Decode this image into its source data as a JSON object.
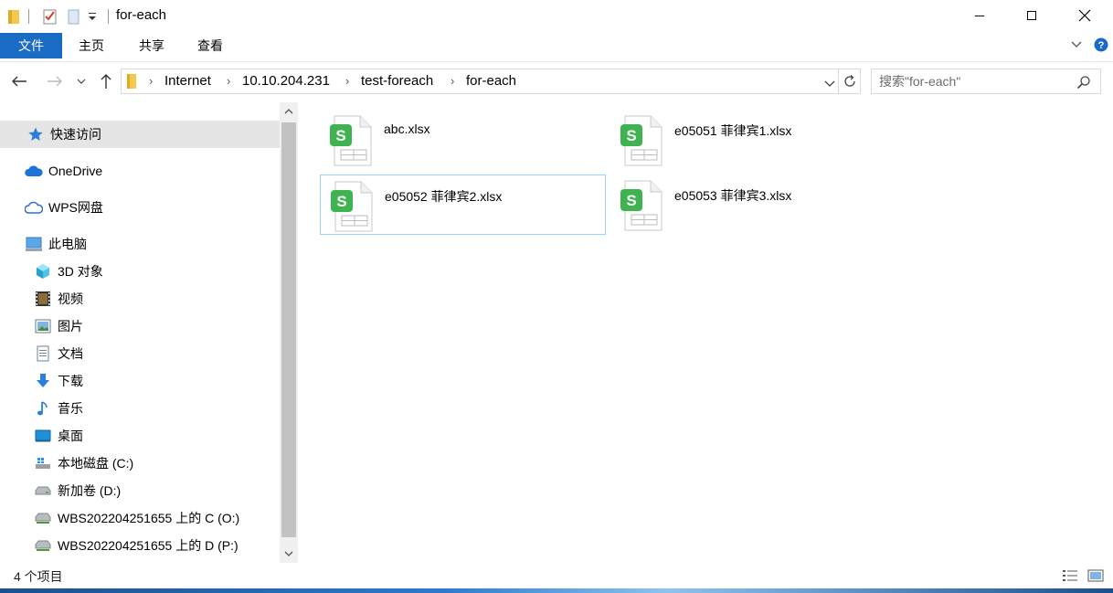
{
  "window": {
    "title": "for-each"
  },
  "ribbon": {
    "tabs": [
      "文件",
      "主页",
      "共享",
      "查看"
    ]
  },
  "address": {
    "crumbs": [
      "Internet",
      "10.10.204.231",
      "test-foreach",
      "for-each"
    ]
  },
  "search": {
    "placeholder": "搜索\"for-each\""
  },
  "sidebar": {
    "items": [
      {
        "label": "快速访问",
        "icon": "star-icon"
      },
      {
        "label": "OneDrive",
        "icon": "onedrive-icon"
      },
      {
        "label": "WPS网盘",
        "icon": "wps-cloud-icon"
      },
      {
        "label": "此电脑",
        "icon": "this-pc-icon"
      },
      {
        "label": "3D 对象",
        "icon": "3d-objects-icon"
      },
      {
        "label": "视频",
        "icon": "video-icon"
      },
      {
        "label": "图片",
        "icon": "pictures-icon"
      },
      {
        "label": "文档",
        "icon": "documents-icon"
      },
      {
        "label": "下载",
        "icon": "download-icon"
      },
      {
        "label": "音乐",
        "icon": "music-icon"
      },
      {
        "label": "桌面",
        "icon": "desktop-icon"
      },
      {
        "label": "本地磁盘 (C:)",
        "icon": "system-drive-icon"
      },
      {
        "label": "新加卷 (D:)",
        "icon": "drive-icon"
      },
      {
        "label": "WBS202204251655 上的 C (O:)",
        "icon": "network-drive-icon"
      },
      {
        "label": "WBS202204251655 上的 D (P:)",
        "icon": "network-drive-icon"
      }
    ]
  },
  "files": [
    {
      "name": "abc.xlsx",
      "icon": "wps-spreadsheet-icon"
    },
    {
      "name": "e05051 菲律宾1.xlsx",
      "icon": "wps-spreadsheet-icon"
    },
    {
      "name": "e05052 菲律宾2.xlsx",
      "icon": "wps-spreadsheet-icon"
    },
    {
      "name": "e05053 菲律宾3.xlsx",
      "icon": "wps-spreadsheet-icon"
    }
  ],
  "status": {
    "item_count": "4 个项目"
  },
  "colors": {
    "accent": "#1a6bc4",
    "selection_border": "#99d1ff",
    "wps_green": "#3eb34f"
  }
}
